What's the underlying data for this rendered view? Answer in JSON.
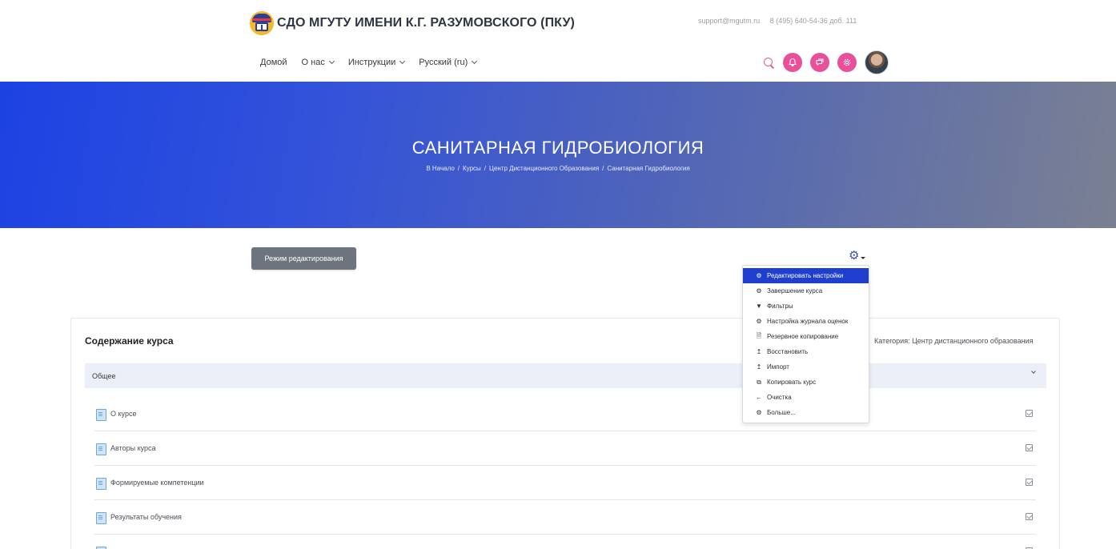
{
  "site": {
    "title": "СДО МГУТУ ИМЕНИ К.Г. РАЗУМОВСКОГО (ПКУ)",
    "email": "support@mgutm.ru",
    "phone": "8 (495) 640-54-36 доб. 111"
  },
  "nav": {
    "home": "Домой",
    "about": "О нас",
    "instructions": "Инструкции",
    "language": "Русский (ru)"
  },
  "icons": {
    "search": "search-icon",
    "notifications": "bell-icon",
    "messages": "chat-icon",
    "settings": "gear-icon",
    "accent_color": "#e8509a"
  },
  "banner": {
    "title": "САНИТАРНАЯ ГИДРОБИОЛОГИЯ",
    "breadcrumbs": [
      "В Начало",
      "Курсы",
      "Центр Дистанционного Образования",
      "Санитарная Гидробиология"
    ],
    "separator": "/"
  },
  "edit_mode_label": "Режим редактирования",
  "menu": {
    "items": [
      {
        "label": "Редактировать настройки",
        "icon": "gear-icon",
        "glyph": "⚙"
      },
      {
        "label": "Завершение курса",
        "icon": "gear-icon",
        "glyph": "⚙"
      },
      {
        "label": "Фильтры",
        "icon": "filter-icon",
        "glyph": "▼"
      },
      {
        "label": "Настройка журнала оценок",
        "icon": "gear-icon",
        "glyph": "⚙"
      },
      {
        "label": "Резервное копирование",
        "icon": "file-icon",
        "glyph": "🗎"
      },
      {
        "label": "Восстановить",
        "icon": "upload-icon",
        "glyph": "↥"
      },
      {
        "label": "Импорт",
        "icon": "upload-icon",
        "glyph": "↥"
      },
      {
        "label": "Копировать курс",
        "icon": "copy-icon",
        "glyph": "⧉"
      },
      {
        "label": "Очистка",
        "icon": "arrow-left-icon",
        "glyph": "←"
      },
      {
        "label": "Больше...",
        "icon": "gear-icon",
        "glyph": "⚙"
      }
    ],
    "active_color": "#1f3fcf"
  },
  "course": {
    "heading": "Содержание курса",
    "category": "Категория: Центр дистанционного образования",
    "section": "Общее",
    "activities": [
      "О курсе",
      "Авторы курса",
      "Формируемые компетенции",
      "Результаты обучения"
    ]
  }
}
